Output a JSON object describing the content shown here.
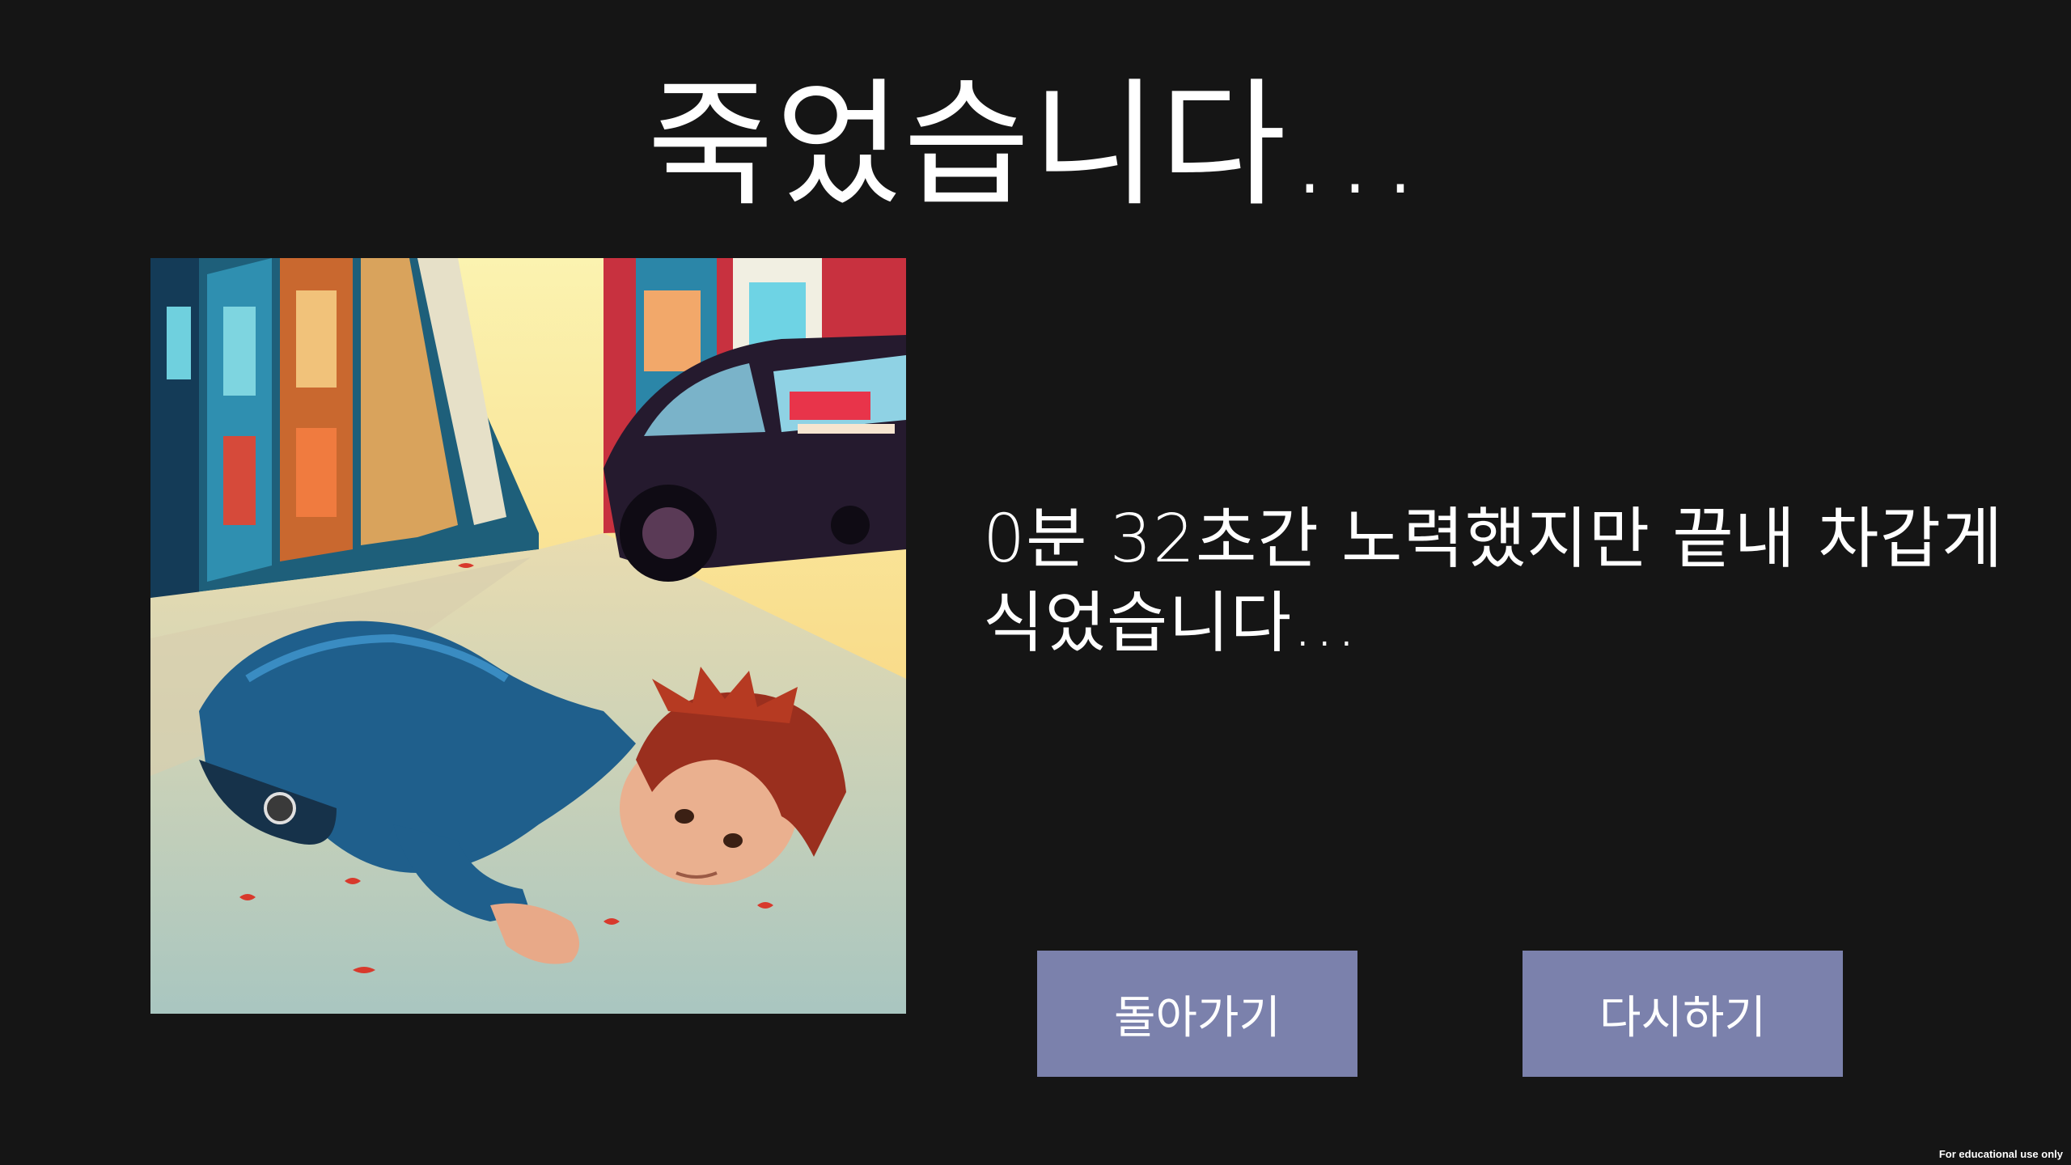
{
  "screen": {
    "title": "죽었습니다...",
    "message": "0분 32초간 노력했지만 끝내 차갑게 식었습니다...",
    "footnote": "For educational use only"
  },
  "buttons": {
    "back_label": "돌아가기",
    "retry_label": "다시하기"
  },
  "illustration": {
    "subject": "comic-style city street scene with a person lying on the road beside a parked car"
  },
  "colors": {
    "background": "#151515",
    "button": "#7b81ac",
    "text": "#ffffff"
  }
}
